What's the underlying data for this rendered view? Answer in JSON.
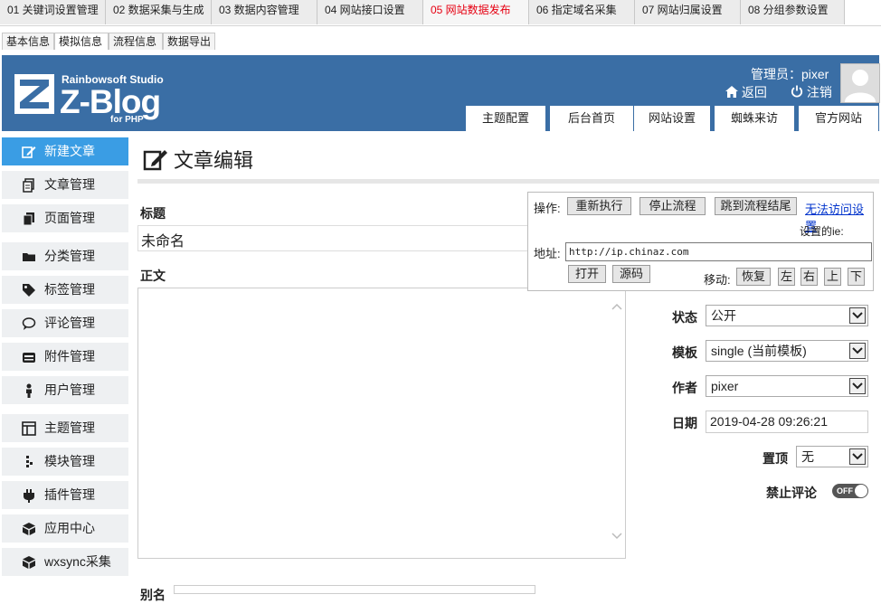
{
  "top_tabs": [
    {
      "label": "01 关键词设置管理",
      "active": false
    },
    {
      "label": "02 数据采集与生成",
      "active": false
    },
    {
      "label": "03 数据内容管理",
      "active": false
    },
    {
      "label": "04 网站接口设置",
      "active": false
    },
    {
      "label": "05 网站数据发布",
      "active": true
    },
    {
      "label": "06 指定域名采集",
      "active": false
    },
    {
      "label": "07 网站归属设置",
      "active": false
    },
    {
      "label": "08 分组参数设置",
      "active": false
    }
  ],
  "sub_tabs": [
    {
      "label": "基本信息",
      "active": false
    },
    {
      "label": "模拟信息",
      "active": true
    },
    {
      "label": "流程信息",
      "active": false
    },
    {
      "label": "数据导出",
      "active": false
    }
  ],
  "header": {
    "logo_studio": "Rainbowsoft Studio",
    "logo_main": "Z-Blog",
    "logo_sub": "for PHP",
    "admin_label": "管理员：pixer",
    "back_label": "返回",
    "logout_label": "注销",
    "nav": [
      "主题配置",
      "后台首页",
      "网站设置",
      "蜘蛛来访",
      "官方网站"
    ],
    "bg_color": "#3a6ea5"
  },
  "sidebar": [
    {
      "label": "新建文章",
      "icon": "edit-icon",
      "active": true
    },
    {
      "label": "文章管理",
      "icon": "articles-icon",
      "active": false
    },
    {
      "label": "页面管理",
      "icon": "pages-icon",
      "active": false
    },
    {
      "label": "分类管理",
      "icon": "folder-icon",
      "active": false
    },
    {
      "label": "标签管理",
      "icon": "tag-icon",
      "active": false
    },
    {
      "label": "评论管理",
      "icon": "comment-icon",
      "active": false
    },
    {
      "label": "附件管理",
      "icon": "attachment-icon",
      "active": false
    },
    {
      "label": "用户管理",
      "icon": "user-icon",
      "active": false
    },
    {
      "label": "主题管理",
      "icon": "theme-icon",
      "active": false
    },
    {
      "label": "模块管理",
      "icon": "module-icon",
      "active": false
    },
    {
      "label": "插件管理",
      "icon": "plugin-icon",
      "active": false
    },
    {
      "label": "应用中心",
      "icon": "app-center-icon",
      "active": false
    },
    {
      "label": "wxsync采集",
      "icon": "wxsync-icon",
      "active": false
    }
  ],
  "editor": {
    "page_title": "文章编辑",
    "title_label": "标题",
    "title_value": "未命名",
    "body_label": "正文"
  },
  "meta": {
    "status_label": "状态",
    "status_value": "公开",
    "template_label": "模板",
    "template_value": "single (当前模板)",
    "author_label": "作者",
    "author_value": "pixer",
    "date_label": "日期",
    "date_value": "2019-04-28 09:26:21",
    "top_label": "置顶",
    "top_value": "无",
    "comments_label": "禁止评论",
    "comments_toggle": "OFF"
  },
  "control_panel": {
    "ops_label": "操作:",
    "rerun": "重新执行",
    "stop": "停止流程",
    "jump_end": "跳到流程结尾",
    "no_access": "无法访问设置",
    "ie_label": "设置的ie:",
    "addr_label": "地址:",
    "addr_value": "http://ip.chinaz.com",
    "open": "打开",
    "source": "源码",
    "move_label": "移动:",
    "restore": "恢复",
    "left": "左",
    "right": "右",
    "up": "上",
    "down": "下"
  },
  "bottom": {
    "label": "别名"
  }
}
